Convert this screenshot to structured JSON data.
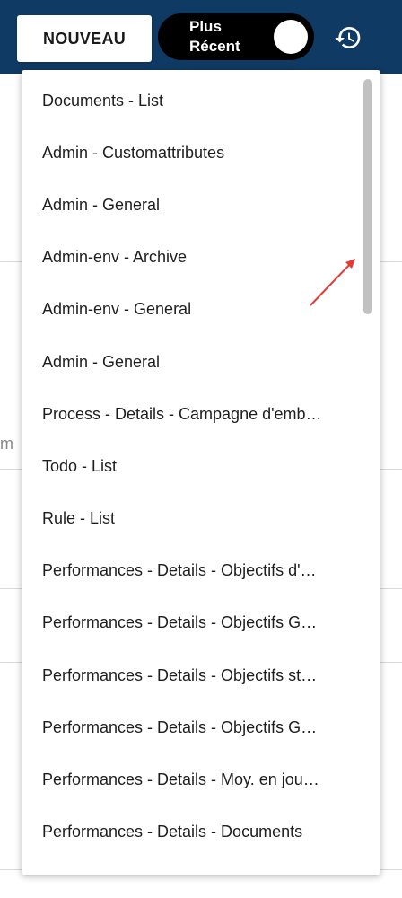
{
  "header": {
    "new_button_label": "NOUVEAU",
    "toggle_label": "Plus\nRécent",
    "history_icon": "history-icon"
  },
  "background": {
    "fragment_text": "m"
  },
  "menu": {
    "items": [
      {
        "label": "Documents - List"
      },
      {
        "label": "Admin - Customattributes"
      },
      {
        "label": "Admin - General"
      },
      {
        "label": "Admin-env - Archive"
      },
      {
        "label": "Admin-env - General"
      },
      {
        "label": "Admin - General"
      },
      {
        "label": "Process - Details - Campagne d'emb…"
      },
      {
        "label": "Todo - List"
      },
      {
        "label": "Rule - List"
      },
      {
        "label": "Performances - Details - Objectifs d'…"
      },
      {
        "label": "Performances - Details - Objectifs G…"
      },
      {
        "label": "Performances - Details - Objectifs st…"
      },
      {
        "label": "Performances - Details - Objectifs G…"
      },
      {
        "label": "Performances - Details - Moy. en jou…"
      },
      {
        "label": "Performances - Details - Documents"
      },
      {
        "label": ""
      }
    ]
  },
  "colors": {
    "header_bg": "#0f3a63",
    "annotation_arrow": "#e53935"
  }
}
